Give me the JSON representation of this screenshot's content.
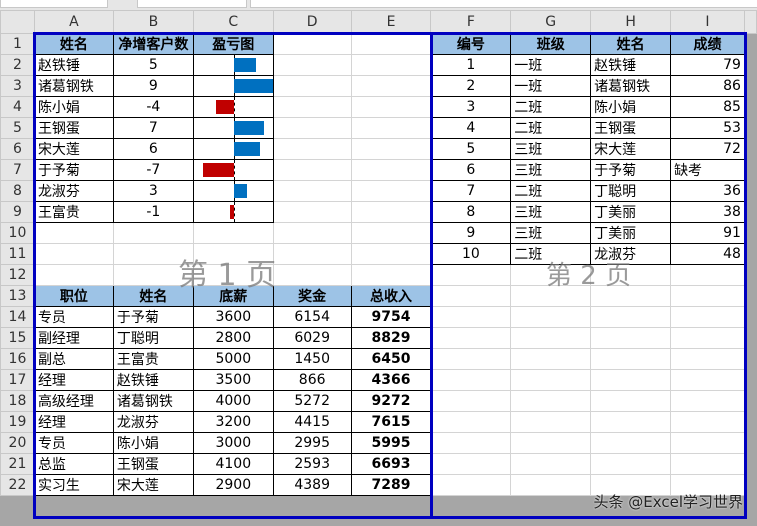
{
  "columns": [
    "A",
    "B",
    "C",
    "D",
    "E",
    "F",
    "G",
    "H",
    "I"
  ],
  "rows": [
    "1",
    "2",
    "3",
    "4",
    "5",
    "6",
    "7",
    "8",
    "9",
    "10",
    "11",
    "12",
    "13",
    "14",
    "15",
    "16",
    "17",
    "18",
    "19",
    "20",
    "21",
    "22"
  ],
  "table1": {
    "headers": [
      "姓名",
      "净增客户数",
      "盈亏图"
    ],
    "rows": [
      [
        "赵铁锤",
        5
      ],
      [
        "诸葛钢铁",
        9
      ],
      [
        "陈小娟",
        -4
      ],
      [
        "王钢蛋",
        7
      ],
      [
        "宋大莲",
        6
      ],
      [
        "于予菊",
        -7
      ],
      [
        "龙淑芬",
        3
      ],
      [
        "王富贵",
        -1
      ]
    ]
  },
  "table2": {
    "headers": [
      "编号",
      "班级",
      "姓名",
      "成绩"
    ],
    "rows": [
      [
        "1",
        "一班",
        "赵铁锤",
        "79"
      ],
      [
        "2",
        "一班",
        "诸葛钢铁",
        "86"
      ],
      [
        "3",
        "二班",
        "陈小娟",
        "85"
      ],
      [
        "4",
        "二班",
        "王钢蛋",
        "53"
      ],
      [
        "5",
        "三班",
        "宋大莲",
        "72"
      ],
      [
        "6",
        "三班",
        "于予菊",
        "缺考"
      ],
      [
        "7",
        "二班",
        "丁聪明",
        "36"
      ],
      [
        "8",
        "三班",
        "丁美丽",
        "38"
      ],
      [
        "9",
        "三班",
        "丁美丽",
        "91"
      ],
      [
        "10",
        "二班",
        "龙淑芬",
        "48"
      ]
    ]
  },
  "table3": {
    "headers": [
      "职位",
      "姓名",
      "底薪",
      "奖金",
      "总收入"
    ],
    "rows": [
      [
        "专员",
        "于予菊",
        "3600",
        "6154",
        "9754"
      ],
      [
        "副经理",
        "丁聪明",
        "2800",
        "6029",
        "8829"
      ],
      [
        "副总",
        "王富贵",
        "5000",
        "1450",
        "6450"
      ],
      [
        "经理",
        "赵铁锤",
        "3500",
        "866",
        "4366"
      ],
      [
        "高级经理",
        "诸葛钢铁",
        "4000",
        "5272",
        "9272"
      ],
      [
        "经理",
        "龙淑芬",
        "3200",
        "4415",
        "7615"
      ],
      [
        "专员",
        "陈小娟",
        "3000",
        "2995",
        "5995"
      ],
      [
        "总监",
        "王钢蛋",
        "4100",
        "2593",
        "6693"
      ],
      [
        "实习生",
        "宋大莲",
        "2900",
        "4389",
        "7289"
      ]
    ]
  },
  "page_labels": [
    "第 1 页",
    "第 2 页"
  ],
  "watermark": "头条 @Excel学习世界",
  "colors": {
    "positive_bar": "#0070c0",
    "negative_bar": "#c00000",
    "header_fill": "#9dc3e6",
    "page_border": "#0000c0"
  }
}
